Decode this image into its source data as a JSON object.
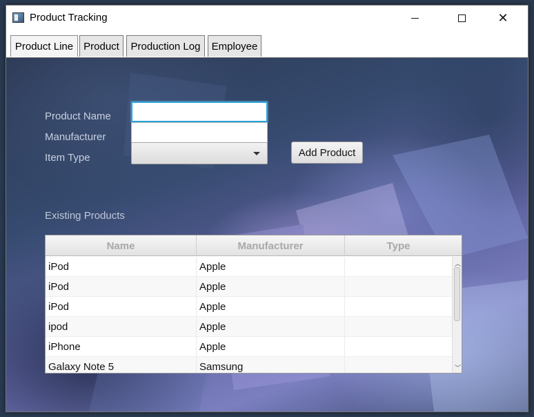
{
  "window": {
    "title": "Product Tracking"
  },
  "tabs": [
    {
      "label": "Product Line"
    },
    {
      "label": "Product"
    },
    {
      "label": "Production Log"
    },
    {
      "label": "Employee"
    }
  ],
  "form": {
    "product_name_label": "Product Name",
    "manufacturer_label": "Manufacturer",
    "item_type_label": "Item Type",
    "product_name_value": "",
    "manufacturer_value": "",
    "item_type_value": "",
    "add_button_label": "Add Product"
  },
  "products": {
    "section_label": "Existing Products",
    "columns": [
      "Name",
      "Manufacturer",
      "Type"
    ],
    "rows": [
      {
        "name": "iPod",
        "manufacturer": "Apple",
        "type": ""
      },
      {
        "name": "iPod",
        "manufacturer": "Apple",
        "type": ""
      },
      {
        "name": "iPod",
        "manufacturer": "Apple",
        "type": ""
      },
      {
        "name": "ipod",
        "manufacturer": "Apple",
        "type": ""
      },
      {
        "name": "iPhone",
        "manufacturer": "Apple",
        "type": ""
      },
      {
        "name": "Galaxy Note 5",
        "manufacturer": "Samsung",
        "type": ""
      }
    ]
  },
  "colors": {
    "focus_border": "#29a3d8",
    "label_text": "#c9d0e0"
  }
}
